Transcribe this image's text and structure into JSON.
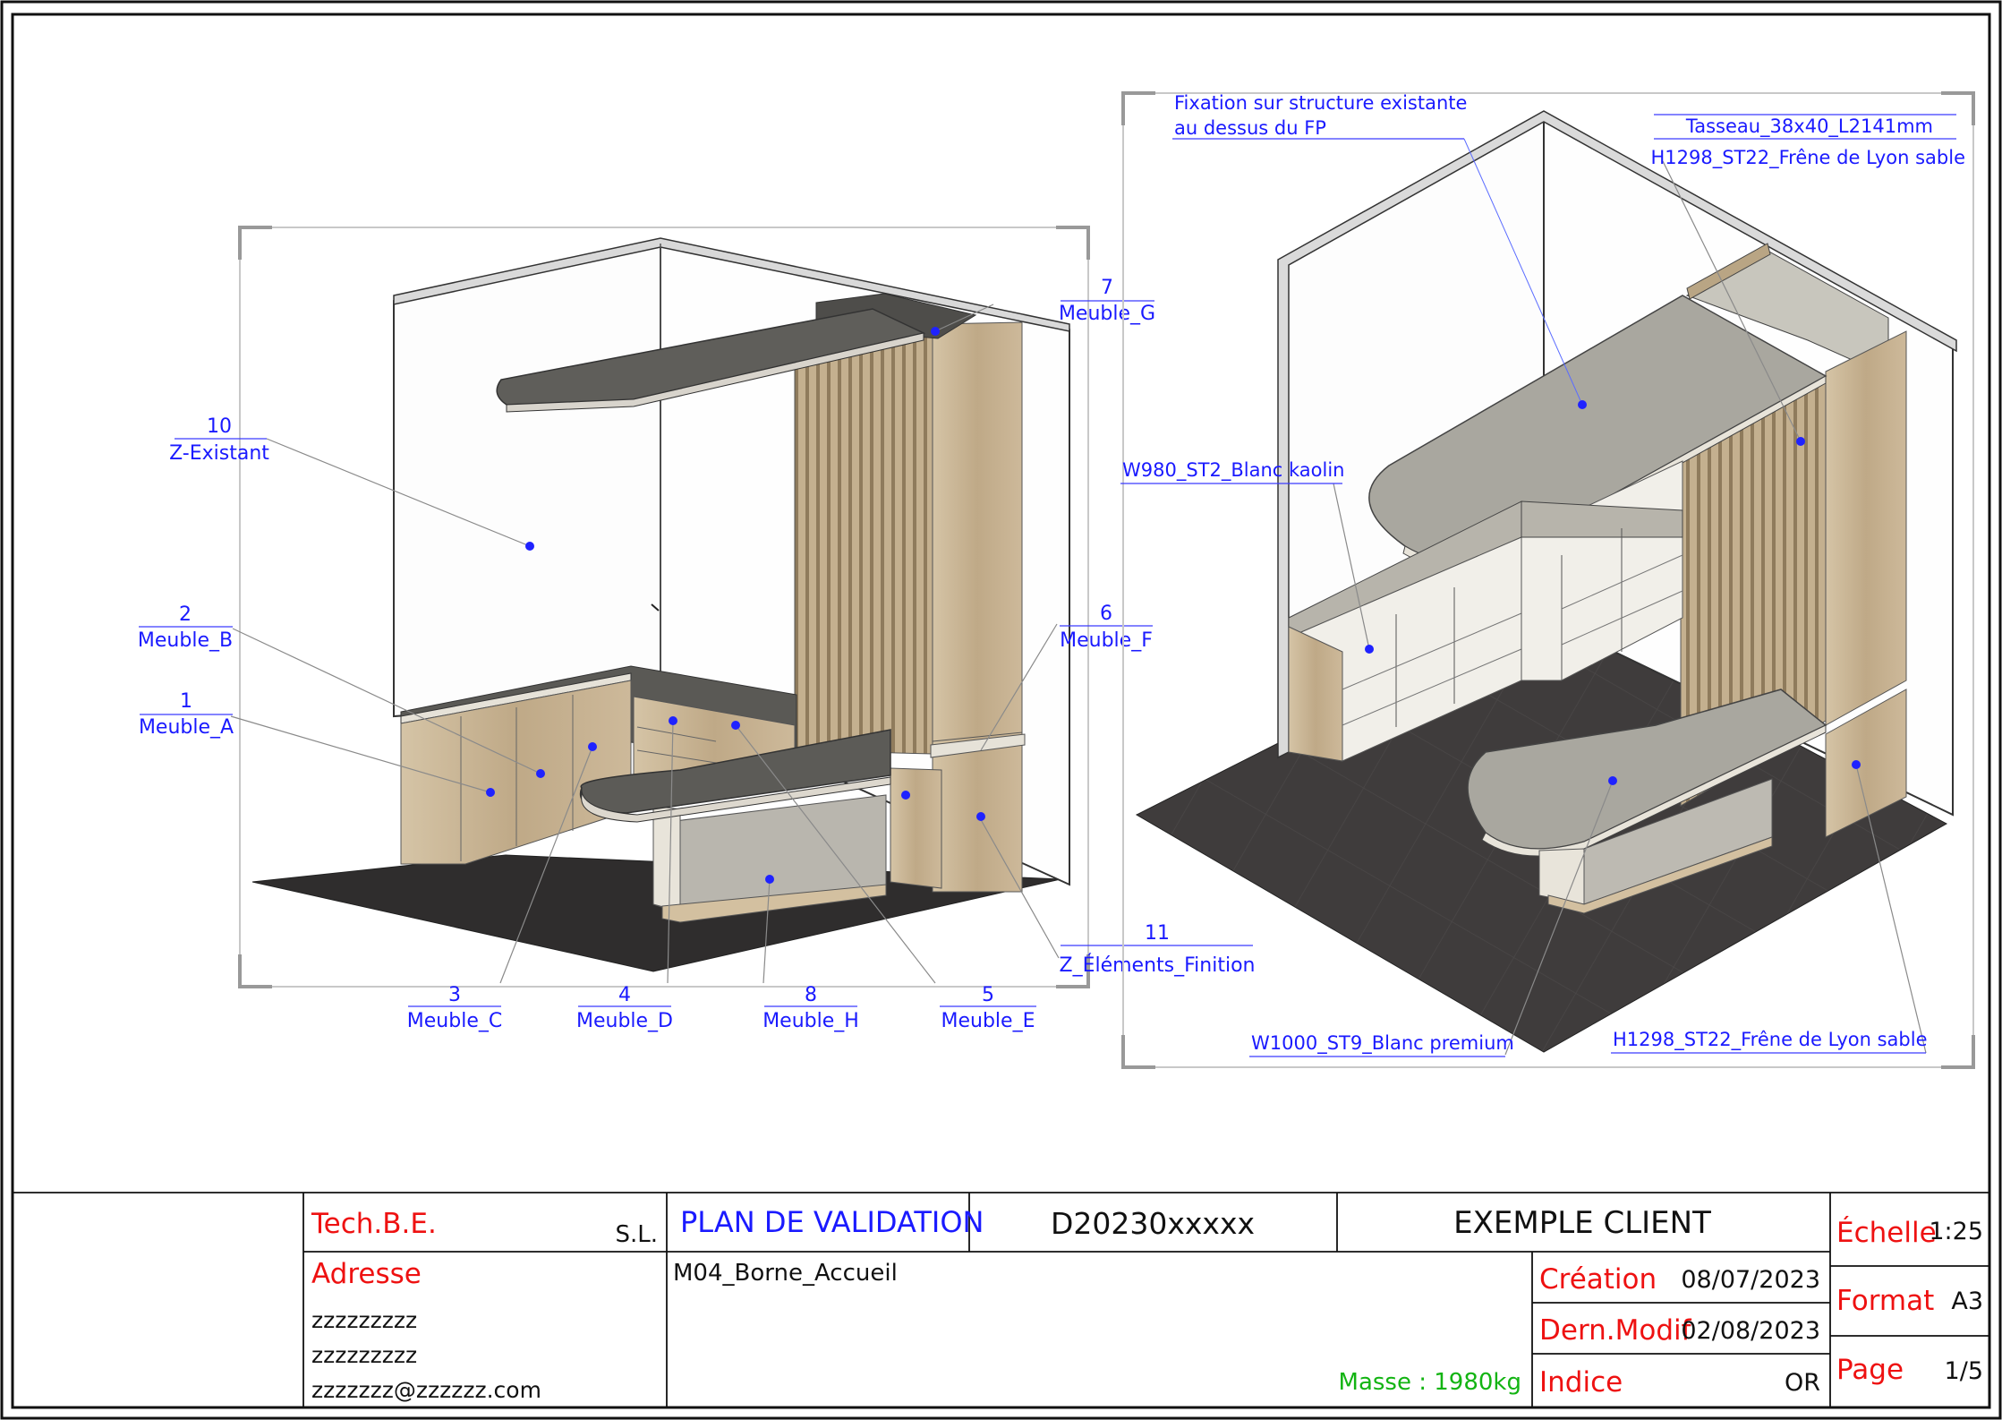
{
  "labels_left": {
    "z_existant": {
      "num": "10",
      "name": "Z-Existant"
    },
    "meuble_b": {
      "num": "2",
      "name": "Meuble_B"
    },
    "meuble_a": {
      "num": "1",
      "name": "Meuble_A"
    },
    "meuble_g": {
      "num": "7",
      "name": "Meuble_G"
    },
    "meuble_f": {
      "num": "6",
      "name": "Meuble_F"
    },
    "z_finition": {
      "num": "11",
      "name": "Z_Éléments_Finition"
    },
    "meuble_c": {
      "num": "3",
      "name": "Meuble_C"
    },
    "meuble_d": {
      "num": "4",
      "name": "Meuble_D"
    },
    "meuble_h": {
      "num": "8",
      "name": "Meuble_H"
    },
    "meuble_e": {
      "num": "5",
      "name": "Meuble_E"
    }
  },
  "labels_right": {
    "fixation_line1": "Fixation sur structure existante",
    "fixation_line2": "au dessus du FP",
    "tasseau": "Tasseau_38x40_L2141mm",
    "frene_top": "H1298_ST22_Frêne de Lyon sable",
    "blanc_kaolin": "W980_ST2_Blanc kaolin",
    "blanc_premium": "W1000_ST9_Blanc premium",
    "frene_bottom": "H1298_ST22_Frêne de Lyon sable"
  },
  "title_block": {
    "company": "Tech.B.E.",
    "company_suffix": "S.L.",
    "plan_type": "PLAN DE VALIDATION",
    "doc_number": "D20230xxxxx",
    "client": "EXEMPLE CLIENT",
    "adresse_label": "Adresse",
    "address_lines": [
      "zzzzzzzzz",
      "zzzzzzzzz",
      "zzzzzzz@zzzzzz.com"
    ],
    "project_name": "M04_Borne_Accueil",
    "masse": "Masse : 1980kg",
    "creation_label": "Création",
    "creation_date": "08/07/2023",
    "modif_label": "Dern.Modif",
    "modif_date": "02/08/2023",
    "indice_label": "Indice",
    "indice_value": "OR",
    "echelle_label": "Échelle",
    "echelle_value": "1:25",
    "format_label": "Format",
    "format_value": "A3",
    "page_label": "Page",
    "page_value": "1/5"
  },
  "colors": {
    "label_blue": "#1a1aff",
    "title_red": "#ee1111",
    "masse_green": "#13b413",
    "floor": "#3a3838",
    "worktop": "#6b6a66",
    "oak": "#c9b79a",
    "white_panel": "#e8e6e0"
  }
}
